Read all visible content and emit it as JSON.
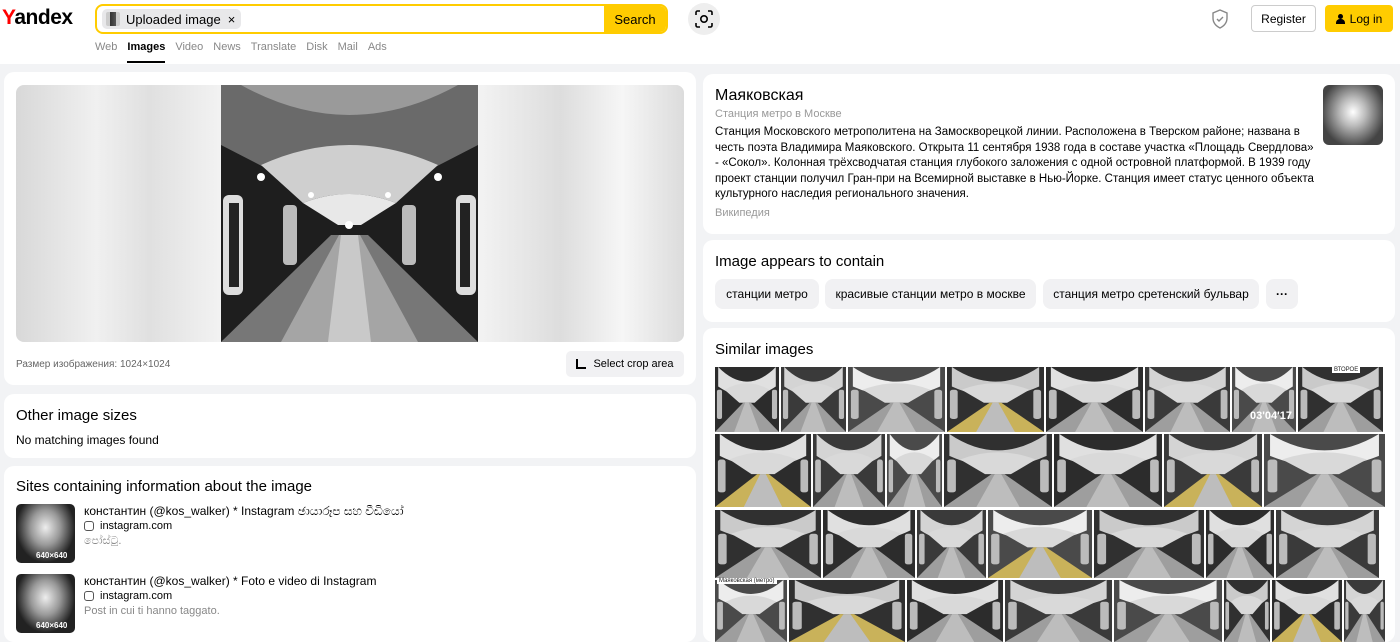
{
  "header": {
    "logo_first": "Y",
    "logo_rest": "andex",
    "search_chip": "Uploaded image",
    "chip_close": "×",
    "search_button": "Search",
    "register": "Register",
    "login": "Log in"
  },
  "tabs": [
    "Web",
    "Images",
    "Video",
    "News",
    "Translate",
    "Disk",
    "Mail",
    "Ads"
  ],
  "active_tab": "Images",
  "image": {
    "size_text": "Размер изображения: 1024×1024",
    "crop_button": "Select crop area"
  },
  "other_sizes": {
    "title": "Other image sizes",
    "text": "No matching images found"
  },
  "sites": {
    "title": "Sites containing information about the image",
    "items": [
      {
        "title": "константин (@kos_walker) * Instagram ඡායාරූප සහ වීඩියෝ",
        "domain": "instagram.com",
        "caption": "පෝස්ටු.",
        "dim": "640×640"
      },
      {
        "title": "константин (@kos_walker) * Foto e video di Instagram",
        "domain": "instagram.com",
        "caption": "Post in cui ti hanno taggato.",
        "dim": "640×640"
      }
    ]
  },
  "wiki": {
    "title": "Маяковская",
    "subtitle": "Станция метро в Москве",
    "text": "Станция Московского метрополитена на Замоскворецкой линии. Расположена в Тверском районе; названа в честь поэта Владимира Маяковского. Открыта 11 сентября 1938 года в составе участка «Площадь Свердлова» - «Сокол». Колонная трёхсводчатая станция глубокого заложения с одной островной платформой. В 1939 году проект станции получил Гран-при на Всемирной выставке в Нью-Йорке. Станция имеет статус ценного объекта культурного наследия регионального значения.",
    "source": "Википедия"
  },
  "contains": {
    "title": "Image appears to contain",
    "tags": [
      "станции метро",
      "красивые станции метро в москве",
      "станция метро сретенский бульвар"
    ],
    "more": "···"
  },
  "similar": {
    "title": "Similar images",
    "overlay_text": "03'04'17",
    "caption_small": "ВТОРОЕ",
    "caption_small2": "Маяковская (метро)"
  },
  "icons": [
    "camera-lens-icon",
    "shield-icon",
    "user-icon",
    "crop-icon",
    "instagram-icon",
    "close-icon"
  ],
  "colors": {
    "accent": "#ffcc00",
    "logo_red": "#ff0000"
  }
}
